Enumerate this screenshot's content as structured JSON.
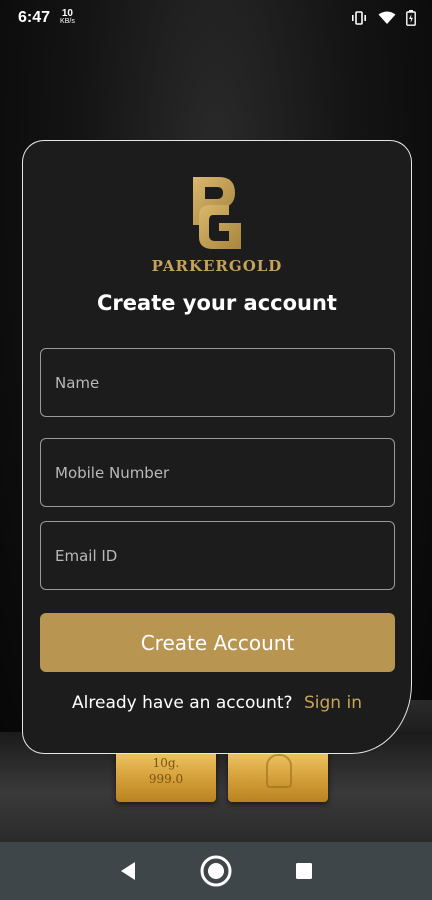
{
  "status_bar": {
    "time": "6:47",
    "speed_value": "10",
    "speed_unit": "KB/s"
  },
  "brand": {
    "name": "PARKERGOLD",
    "color": "#c6a35a"
  },
  "form": {
    "title": "Create your account",
    "name_placeholder": "Name",
    "mobile_placeholder": "Mobile Number",
    "email_placeholder": "Email ID",
    "submit_label": "Create Account",
    "signin_prompt": "Already have an account?",
    "signin_link": "Sign in",
    "accent_color": "#b89550"
  },
  "background": {
    "bar1_weight": "10g.",
    "bar1_purity": "999.0"
  },
  "nav_bar": {
    "icons": [
      "back-icon",
      "home-icon",
      "recents-icon"
    ]
  }
}
